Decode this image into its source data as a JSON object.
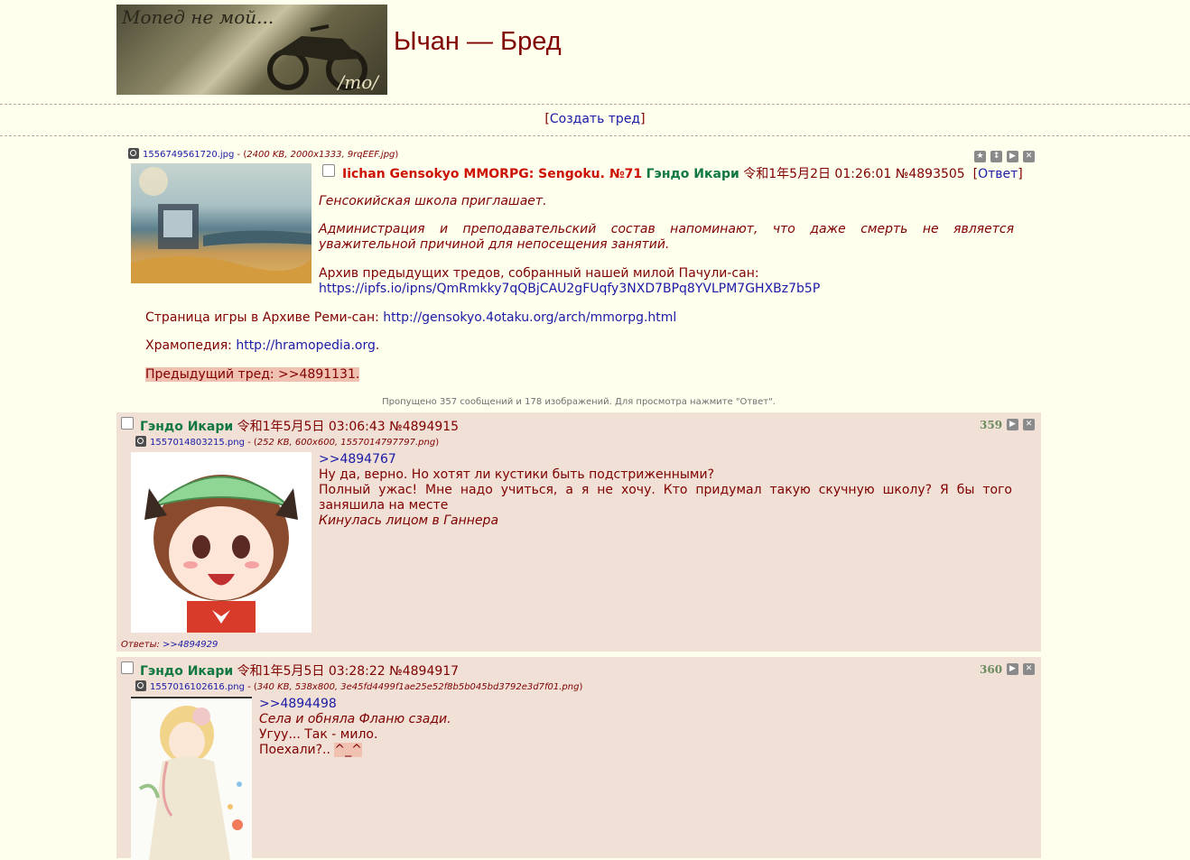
{
  "header": {
    "logo_text": "Мопед не мой...",
    "logo_board": "/mo/",
    "board_title": "Ычан — Бред",
    "create_thread_open": "[",
    "create_thread_label": "Создать тред",
    "create_thread_close": "]"
  },
  "op": {
    "file_name": "1556749561720.jpg",
    "file_meta_prefix": " - (",
    "file_meta": "2400 KB, 2000x1333, 9rqEEF.jpg",
    "file_meta_suffix": ")",
    "subject": "Iichan Gensokyo MMORPG: Sengoku. №71",
    "name": "Гэндо Икари",
    "date": "令和1年5月2日 01:26:01",
    "post_no": "№4893505",
    "reply_open": "[",
    "reply_label": "Ответ",
    "reply_close": "]",
    "p1": "Генсокийская школа приглашает.",
    "p2": "Администрация и преподавательский состав напоминают, что даже смерть не является уважительной причиной для непосещения занятий.",
    "p3_text": "Архив предыдущих тредов, собранный нашей милой Пачули-сан:",
    "p3_link": "https://ipfs.io/ipns/QmRmkky7qQBjCAU2gFUqfy3NXD7BPq8YVLPM7GHXBz7b5P",
    "p4_text": "Страница игры в Архиве Реми-сан: ",
    "p4_link": "http://gensokyo.4otaku.org/arch/mmorpg.html",
    "p5_text": "Храмопедия: ",
    "p5_link": "http://hramopedia.org",
    "p5_dot": ".",
    "p6": "Предыдущий тред: >>4891131."
  },
  "omitted": "Пропущено 357 сообщений и 178 изображений. Для просмотра нажмите \"Ответ\".",
  "replies": [
    {
      "name": "Гэндо Икари",
      "date": "令和1年5月5日 03:06:43",
      "post_no": "№4894915",
      "count": "359",
      "file_name": "1557014803215.png",
      "file_meta_prefix": " - (",
      "file_meta": "252 KB, 600x600, 1557014797797.png",
      "file_meta_suffix": ")",
      "ref": ">>4894767",
      "l1": "Ну да, верно. Но хотят ли кустики быть подстриженными?",
      "l2": "Полный ужас! Мне надо учиться, а я не хочу. Кто придумал такую скучную школу? Я бы того заняшила на месте",
      "l3": "Кинулась лицом в Ганнера",
      "answers_label": "Ответы: ",
      "answers_link": ">>4894929"
    },
    {
      "name": "Гэндо Икари",
      "date": "令和1年5月5日 03:28:22",
      "post_no": "№4894917",
      "count": "360",
      "file_name": "1557016102616.png",
      "file_meta_prefix": " - (",
      "file_meta": "340 KB, 538x800, 3e45fd4499f1ae25e52f8b5b045bd3792e3d7f01.png",
      "file_meta_suffix": ")",
      "ref": ">>4894498",
      "l1": "Села и обняла Фланю сзади.",
      "l2": "Угуу... Так - мило.",
      "l3_text": "Поехали?.. ",
      "l3_emote": "^_^"
    }
  ]
}
